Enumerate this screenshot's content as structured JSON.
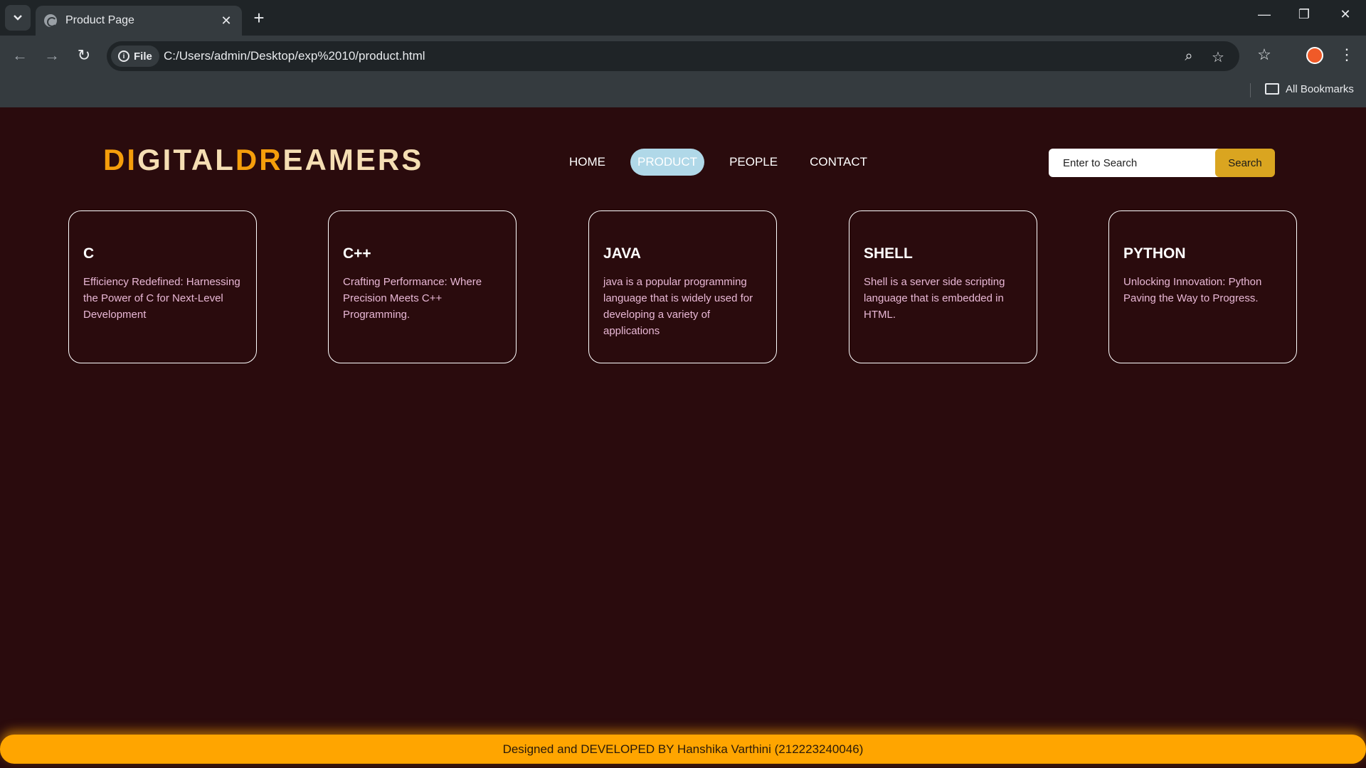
{
  "browser": {
    "tab_title": "Product Page",
    "tab_close": "✕",
    "new_tab": "+",
    "chip_label": "File",
    "url": "C:/Users/admin/Desktop/exp%2010/product.html",
    "bookmarks_label": "All Bookmarks",
    "window_controls": {
      "minimize": "—",
      "restore": "❐",
      "close": "✕"
    },
    "icons": [
      "chevron-down-icon",
      "back-icon",
      "forward-icon",
      "reload-icon",
      "info-icon",
      "zoom-icon",
      "star-icon",
      "bookmarks-icon",
      "profile-icon",
      "menu-icon",
      "folder-icon"
    ]
  },
  "site": {
    "logo": {
      "part1": "DI",
      "part2": "GITAL",
      "part3": "DR",
      "part4": "EAMERS"
    },
    "nav": [
      {
        "label": "HOME",
        "active": false
      },
      {
        "label": "PRODUCT",
        "active": true
      },
      {
        "label": "PEOPLE",
        "active": false
      },
      {
        "label": "CONTACT",
        "active": false
      }
    ],
    "search": {
      "placeholder": "Enter to Search",
      "button": "Search"
    },
    "cards": [
      {
        "title": "C",
        "text": "Efficiency Redefined: Harnessing the Power of C for Next-Level Development"
      },
      {
        "title": "C++",
        "text": "Crafting Performance: Where Precision Meets C++ Programming."
      },
      {
        "title": "JAVA",
        "text": "java is a popular programming language that is widely used for developing a variety of applications"
      },
      {
        "title": "SHELL",
        "text": "Shell is a server side scripting language that is embedded in HTML."
      },
      {
        "title": "PYTHON",
        "text": "Unlocking Innovation: Python Paving the Way to Progress."
      }
    ],
    "footer": "Designed and DEVELOPED BY Hanshika Varthini (212223240046)",
    "colors": {
      "background": "#2a0b0d",
      "accent": "#f59e0b",
      "footer": "#ffa500",
      "active_nav": "#b0d8e8",
      "search_button": "#daa520"
    }
  }
}
